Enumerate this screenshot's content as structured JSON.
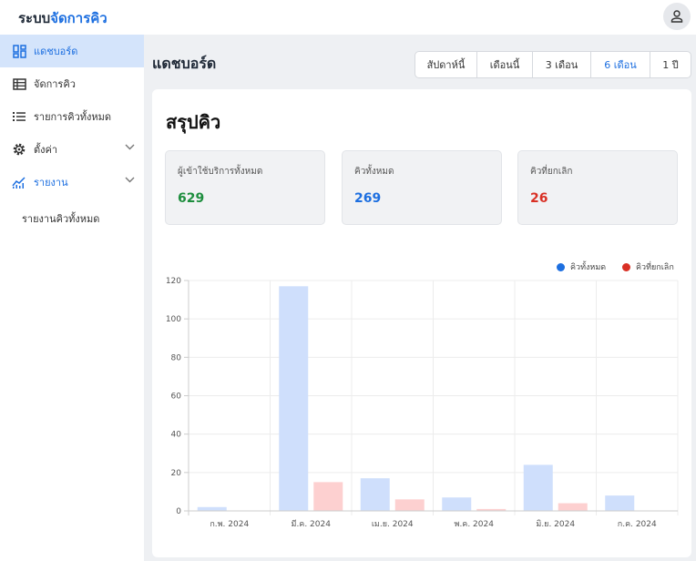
{
  "app": {
    "brand_prefix": "ระบบ",
    "brand_accent": "จัดการคิว"
  },
  "sidebar": {
    "items": [
      {
        "label": "แดชบอร์ด",
        "icon": "dashboard-icon"
      },
      {
        "label": "จัดการคิว",
        "icon": "table-icon"
      },
      {
        "label": "รายการคิวทั้งหมด",
        "icon": "list-icon"
      },
      {
        "label": "ตั้งค่า",
        "icon": "gear-icon"
      },
      {
        "label": "รายงาน",
        "icon": "report-chart-icon"
      }
    ],
    "sub_items": [
      {
        "label": "รายงานคิวทั้งหมด"
      }
    ]
  },
  "header": {
    "title": "แดชบอร์ด"
  },
  "range_tabs": [
    {
      "label": "สัปดาห์นี้"
    },
    {
      "label": "เดือนนี้"
    },
    {
      "label": "3 เดือน"
    },
    {
      "label": "6 เดือน",
      "active": true
    },
    {
      "label": "1 ปี"
    }
  ],
  "summary": {
    "title": "สรุปคิว",
    "stats": [
      {
        "label": "ผู้เข้าใช้บริการทั้งหมด",
        "value": "629",
        "color": "#1e8e3e"
      },
      {
        "label": "คิวทั้งหมด",
        "value": "269",
        "color": "#1d6fe0"
      },
      {
        "label": "คิวที่ยกเลิก",
        "value": "26",
        "color": "#d93025"
      }
    ]
  },
  "chart_data": {
    "type": "bar",
    "categories": [
      "ก.พ. 2024",
      "มี.ค. 2024",
      "เม.ย. 2024",
      "พ.ค. 2024",
      "มิ.ย. 2024",
      "ก.ค. 2024"
    ],
    "series": [
      {
        "name": "คิวทั้งหมด",
        "values": [
          2,
          117,
          17,
          7,
          24,
          8
        ],
        "color": "#cfdffc",
        "legend_color": "#1d6fe0"
      },
      {
        "name": "คิวที่ยกเลิก",
        "values": [
          0,
          15,
          6,
          1,
          4,
          0
        ],
        "color": "#fdd0d0",
        "legend_color": "#d93025"
      }
    ],
    "ylim": [
      0,
      120
    ],
    "yticks": [
      0,
      20,
      40,
      60,
      80,
      100,
      120
    ],
    "grid": true,
    "legend": "top-right"
  }
}
